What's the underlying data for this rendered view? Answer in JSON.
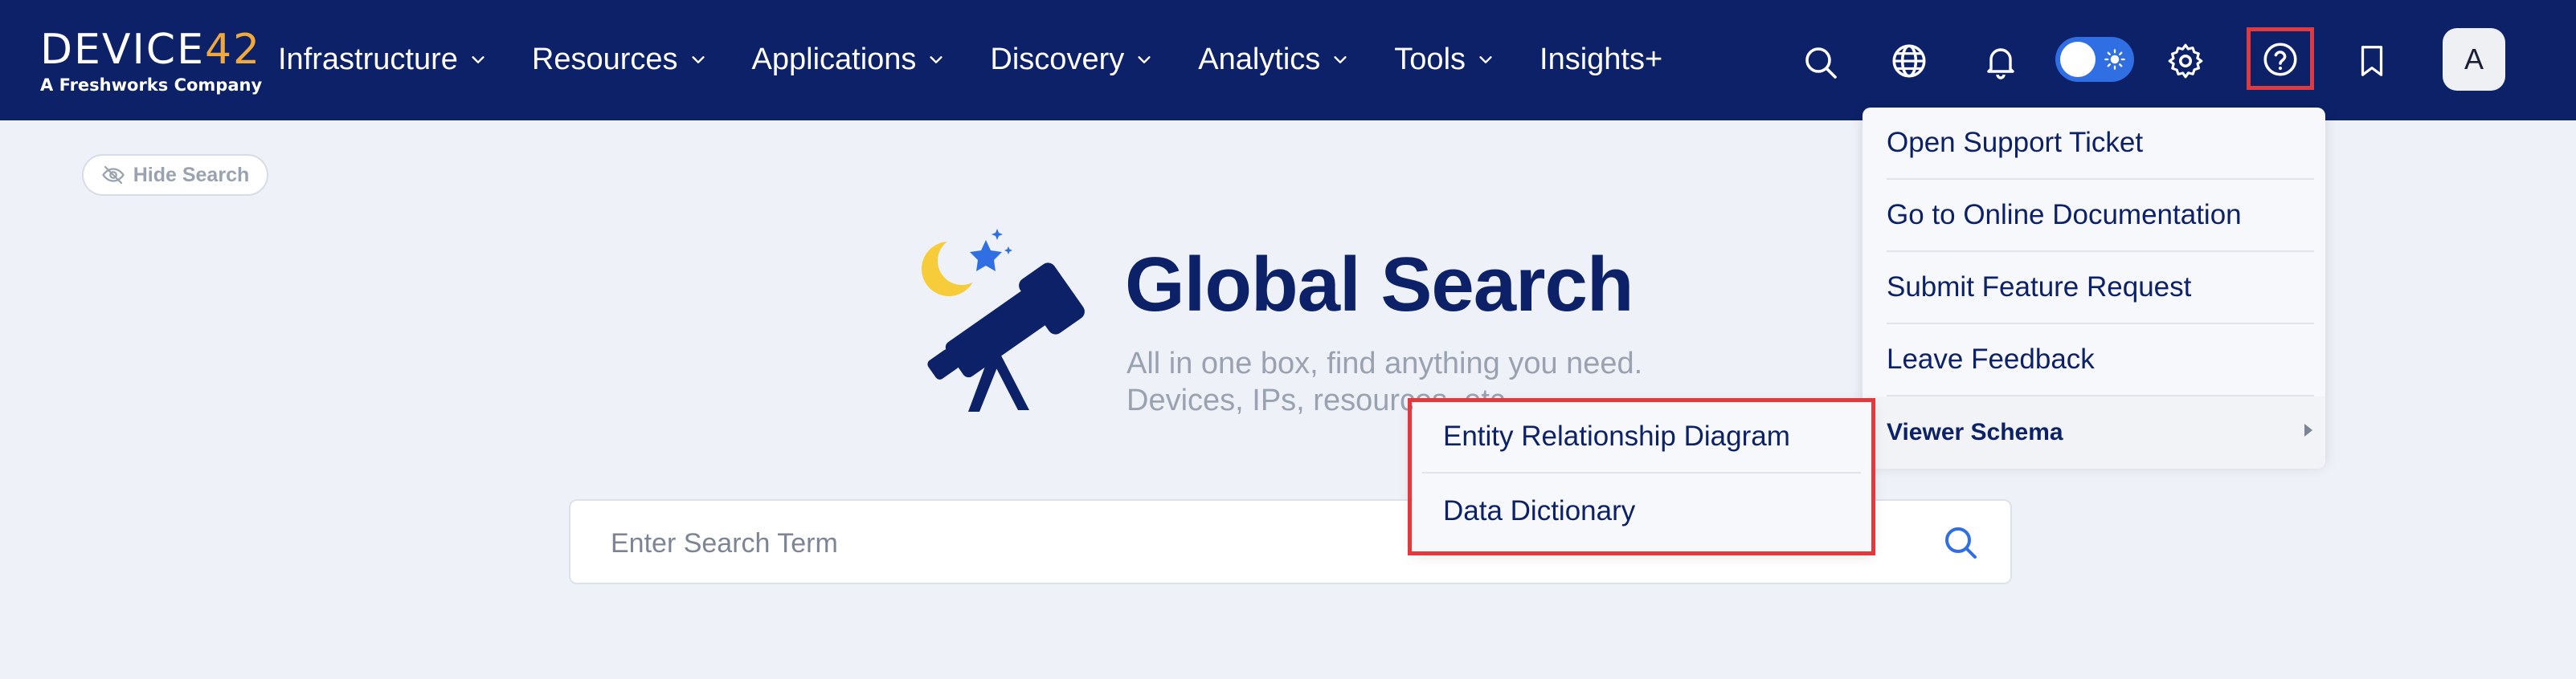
{
  "brand": {
    "word": "DEVICE",
    "number": "42",
    "tagline": "A Freshworks Company"
  },
  "nav": {
    "items": [
      {
        "label": "Infrastructure",
        "has_dropdown": true
      },
      {
        "label": "Resources",
        "has_dropdown": true
      },
      {
        "label": "Applications",
        "has_dropdown": true
      },
      {
        "label": "Discovery",
        "has_dropdown": true
      },
      {
        "label": "Analytics",
        "has_dropdown": true
      },
      {
        "label": "Tools",
        "has_dropdown": true
      },
      {
        "label": "Insights+",
        "has_dropdown": false
      }
    ],
    "icons": [
      "search-icon",
      "globe-icon",
      "bell-icon",
      "theme-toggle",
      "gear-icon",
      "help-icon",
      "bookmark-icon"
    ],
    "avatar_initial": "A"
  },
  "hide_search": {
    "label": "Hide Search",
    "icon": "eye-off-icon"
  },
  "hero": {
    "title": "Global Search",
    "subtitle_line1": "All in one box, find anything you need.",
    "subtitle_line2": "Devices, IPs, resources, etc."
  },
  "search": {
    "placeholder": "Enter Search Term",
    "value": ""
  },
  "help_menu": {
    "items": [
      {
        "label": "Open Support Ticket"
      },
      {
        "label": "Go to Online Documentation"
      },
      {
        "label": "Submit Feature Request"
      },
      {
        "label": "Leave Feedback"
      },
      {
        "label": "Viewer Schema",
        "has_submenu": true
      }
    ]
  },
  "viewer_schema_submenu": {
    "items": [
      {
        "label": "Entity Relationship Diagram"
      },
      {
        "label": "Data Dictionary"
      }
    ]
  },
  "colors": {
    "nav_bg": "#0c2167",
    "page_bg": "#eef2f8",
    "accent": "#2f6ee3",
    "brand_orange": "#f2a93b",
    "highlight_red": "#e0393e",
    "star_blue": "#2f6ee3",
    "moon_yellow": "#f6cc3a"
  }
}
